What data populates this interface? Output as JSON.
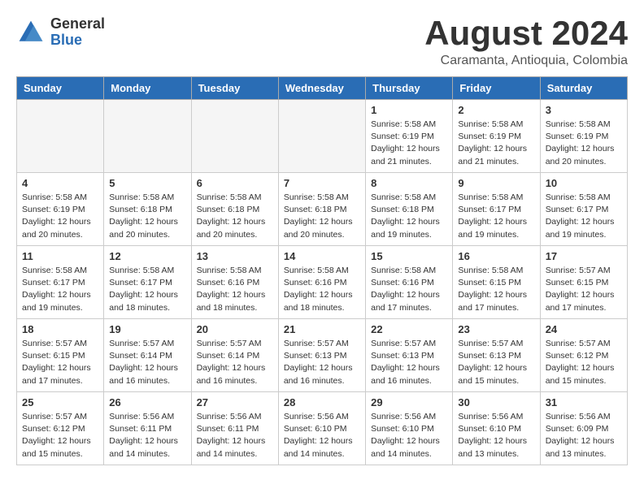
{
  "header": {
    "logo_general": "General",
    "logo_blue": "Blue",
    "month_title": "August 2024",
    "subtitle": "Caramanta, Antioquia, Colombia"
  },
  "weekdays": [
    "Sunday",
    "Monday",
    "Tuesday",
    "Wednesday",
    "Thursday",
    "Friday",
    "Saturday"
  ],
  "weeks": [
    [
      {
        "day": "",
        "info": ""
      },
      {
        "day": "",
        "info": ""
      },
      {
        "day": "",
        "info": ""
      },
      {
        "day": "",
        "info": ""
      },
      {
        "day": "1",
        "info": "Sunrise: 5:58 AM\nSunset: 6:19 PM\nDaylight: 12 hours\nand 21 minutes."
      },
      {
        "day": "2",
        "info": "Sunrise: 5:58 AM\nSunset: 6:19 PM\nDaylight: 12 hours\nand 21 minutes."
      },
      {
        "day": "3",
        "info": "Sunrise: 5:58 AM\nSunset: 6:19 PM\nDaylight: 12 hours\nand 20 minutes."
      }
    ],
    [
      {
        "day": "4",
        "info": "Sunrise: 5:58 AM\nSunset: 6:19 PM\nDaylight: 12 hours\nand 20 minutes."
      },
      {
        "day": "5",
        "info": "Sunrise: 5:58 AM\nSunset: 6:18 PM\nDaylight: 12 hours\nand 20 minutes."
      },
      {
        "day": "6",
        "info": "Sunrise: 5:58 AM\nSunset: 6:18 PM\nDaylight: 12 hours\nand 20 minutes."
      },
      {
        "day": "7",
        "info": "Sunrise: 5:58 AM\nSunset: 6:18 PM\nDaylight: 12 hours\nand 20 minutes."
      },
      {
        "day": "8",
        "info": "Sunrise: 5:58 AM\nSunset: 6:18 PM\nDaylight: 12 hours\nand 19 minutes."
      },
      {
        "day": "9",
        "info": "Sunrise: 5:58 AM\nSunset: 6:17 PM\nDaylight: 12 hours\nand 19 minutes."
      },
      {
        "day": "10",
        "info": "Sunrise: 5:58 AM\nSunset: 6:17 PM\nDaylight: 12 hours\nand 19 minutes."
      }
    ],
    [
      {
        "day": "11",
        "info": "Sunrise: 5:58 AM\nSunset: 6:17 PM\nDaylight: 12 hours\nand 19 minutes."
      },
      {
        "day": "12",
        "info": "Sunrise: 5:58 AM\nSunset: 6:17 PM\nDaylight: 12 hours\nand 18 minutes."
      },
      {
        "day": "13",
        "info": "Sunrise: 5:58 AM\nSunset: 6:16 PM\nDaylight: 12 hours\nand 18 minutes."
      },
      {
        "day": "14",
        "info": "Sunrise: 5:58 AM\nSunset: 6:16 PM\nDaylight: 12 hours\nand 18 minutes."
      },
      {
        "day": "15",
        "info": "Sunrise: 5:58 AM\nSunset: 6:16 PM\nDaylight: 12 hours\nand 17 minutes."
      },
      {
        "day": "16",
        "info": "Sunrise: 5:58 AM\nSunset: 6:15 PM\nDaylight: 12 hours\nand 17 minutes."
      },
      {
        "day": "17",
        "info": "Sunrise: 5:57 AM\nSunset: 6:15 PM\nDaylight: 12 hours\nand 17 minutes."
      }
    ],
    [
      {
        "day": "18",
        "info": "Sunrise: 5:57 AM\nSunset: 6:15 PM\nDaylight: 12 hours\nand 17 minutes."
      },
      {
        "day": "19",
        "info": "Sunrise: 5:57 AM\nSunset: 6:14 PM\nDaylight: 12 hours\nand 16 minutes."
      },
      {
        "day": "20",
        "info": "Sunrise: 5:57 AM\nSunset: 6:14 PM\nDaylight: 12 hours\nand 16 minutes."
      },
      {
        "day": "21",
        "info": "Sunrise: 5:57 AM\nSunset: 6:13 PM\nDaylight: 12 hours\nand 16 minutes."
      },
      {
        "day": "22",
        "info": "Sunrise: 5:57 AM\nSunset: 6:13 PM\nDaylight: 12 hours\nand 16 minutes."
      },
      {
        "day": "23",
        "info": "Sunrise: 5:57 AM\nSunset: 6:13 PM\nDaylight: 12 hours\nand 15 minutes."
      },
      {
        "day": "24",
        "info": "Sunrise: 5:57 AM\nSunset: 6:12 PM\nDaylight: 12 hours\nand 15 minutes."
      }
    ],
    [
      {
        "day": "25",
        "info": "Sunrise: 5:57 AM\nSunset: 6:12 PM\nDaylight: 12 hours\nand 15 minutes."
      },
      {
        "day": "26",
        "info": "Sunrise: 5:56 AM\nSunset: 6:11 PM\nDaylight: 12 hours\nand 14 minutes."
      },
      {
        "day": "27",
        "info": "Sunrise: 5:56 AM\nSunset: 6:11 PM\nDaylight: 12 hours\nand 14 minutes."
      },
      {
        "day": "28",
        "info": "Sunrise: 5:56 AM\nSunset: 6:10 PM\nDaylight: 12 hours\nand 14 minutes."
      },
      {
        "day": "29",
        "info": "Sunrise: 5:56 AM\nSunset: 6:10 PM\nDaylight: 12 hours\nand 14 minutes."
      },
      {
        "day": "30",
        "info": "Sunrise: 5:56 AM\nSunset: 6:10 PM\nDaylight: 12 hours\nand 13 minutes."
      },
      {
        "day": "31",
        "info": "Sunrise: 5:56 AM\nSunset: 6:09 PM\nDaylight: 12 hours\nand 13 minutes."
      }
    ]
  ]
}
